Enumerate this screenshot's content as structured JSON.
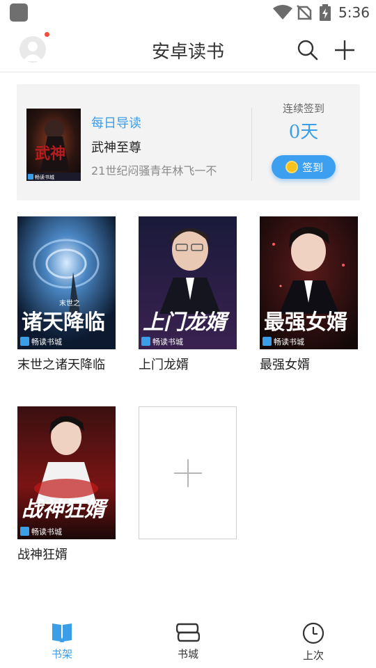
{
  "status_bar": {
    "time": "5:36"
  },
  "header": {
    "title": "安卓读书"
  },
  "daily": {
    "tag": "每日导读",
    "book_title": "武神至尊",
    "description": "21世纪闷骚青年林飞一不",
    "sign_label": "连续签到",
    "sign_days": "0天",
    "sign_button": "签到",
    "cover_text": "武神",
    "cover_brand": "畅读书城"
  },
  "shelf": {
    "books": [
      {
        "title": "末世之诸天降临",
        "cover_text": "诸天降临",
        "cover_small": "末世之",
        "cover_brand": "畅读书城"
      },
      {
        "title": "上门龙婿",
        "cover_text": "上门龙婿",
        "cover_brand": "畅读书城"
      },
      {
        "title": "最强女婿",
        "cover_text": "最强女婿",
        "cover_brand": "畅读书城"
      },
      {
        "title": "战神狂婿",
        "cover_text": "战神狂婿",
        "cover_brand": "畅读书城"
      }
    ]
  },
  "bottom_nav": {
    "items": [
      {
        "label": "书架",
        "icon": "bookshelf-icon",
        "active": true
      },
      {
        "label": "书城",
        "icon": "bookstore-icon",
        "active": false
      },
      {
        "label": "上次",
        "icon": "clock-icon",
        "active": false
      }
    ]
  },
  "colors": {
    "accent": "#3a9ee8",
    "badge": "#f24c3d",
    "coin": "#f7c11e"
  }
}
